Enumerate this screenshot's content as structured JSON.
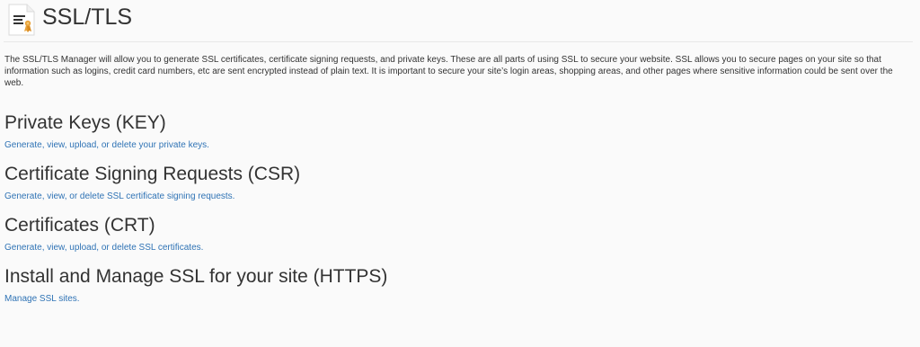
{
  "header": {
    "icon": "ssl-certificate-icon",
    "title": "SSL/TLS"
  },
  "intro": {
    "text": "The SSL/TLS Manager will allow you to generate SSL certificates, certificate signing requests, and private keys. These are all parts of using SSL to secure your website. SSL allows you to secure pages on your site so that information such as logins, credit card numbers, etc are sent encrypted instead of plain text. It is important to secure your site’s login areas, shopping areas, and other pages where sensitive information could be sent over the web."
  },
  "sections": [
    {
      "heading": "Private Keys (KEY)",
      "link": "Generate, view, upload, or delete your private keys."
    },
    {
      "heading": "Certificate Signing Requests (CSR)",
      "link": "Generate, view, or delete SSL certificate signing requests."
    },
    {
      "heading": "Certificates (CRT)",
      "link": "Generate, view, upload, or delete SSL certificates."
    },
    {
      "heading": "Install and Manage SSL for your site (HTTPS)",
      "link": "Manage SSL sites."
    }
  ],
  "colors": {
    "link": "#2f73b5",
    "text": "#333333",
    "background": "#fafafa",
    "badge": "#e8a23a"
  }
}
